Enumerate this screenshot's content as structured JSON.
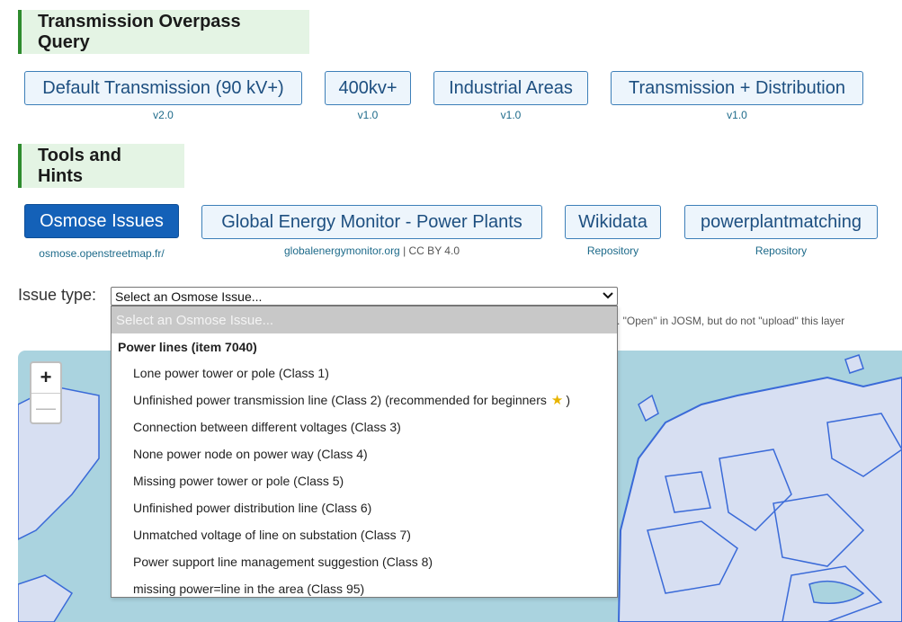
{
  "sections": {
    "transmission": "Transmission Overpass Query",
    "tools": "Tools and Hints"
  },
  "transmission_buttons": [
    {
      "label": "Default Transmission (90 kV+)",
      "version": "v2.0"
    },
    {
      "label": "400kv+",
      "version": "v1.0"
    },
    {
      "label": "Industrial Areas",
      "version": "v1.0"
    },
    {
      "label": "Transmission + Distribution",
      "version": "v1.0"
    }
  ],
  "tool_buttons": [
    {
      "label": "Osmose Issues",
      "sub": "osmose.openstreetmap.fr/",
      "active": true
    },
    {
      "label": "Global Energy Monitor - Power Plants",
      "sub": "globalenergymonitor.org",
      "sub_extra": " | CC BY 4.0"
    },
    {
      "label": "Wikidata",
      "sub": "Repository"
    },
    {
      "label": "powerplantmatching",
      "sub": "Repository"
    }
  ],
  "issue": {
    "label": "Issue type:",
    "selected": "Select an Osmose Issue...",
    "hint": ". \"Open\" in JOSM, but do not \"upload\" this layer",
    "dropdown": {
      "placeholder": "Select an Osmose Issue...",
      "group": "Power lines (item 7040)",
      "options": [
        "Lone power tower or pole (Class 1)",
        "Unfinished power transmission line (Class 2) (recommended for beginners",
        "Connection between different voltages (Class 3)",
        "None power node on power way (Class 4)",
        "Missing power tower or pole (Class 5)",
        "Unfinished power distribution line (Class 6)",
        "Unmatched voltage of line on substation (Class 7)",
        "Power support line management suggestion (Class 8)",
        "missing power=line in the area (Class 95)"
      ],
      "recommended_suffix": ")"
    }
  },
  "map": {
    "zoom_in": "+",
    "zoom_out": "—"
  },
  "colors": {
    "water": "#aad3df",
    "land": "#d7dff2",
    "border": "#3a6ad8",
    "accent": "#1461b8"
  },
  "icons": {
    "recommended": "star-icon",
    "select_caret": "chevron-down-icon"
  }
}
